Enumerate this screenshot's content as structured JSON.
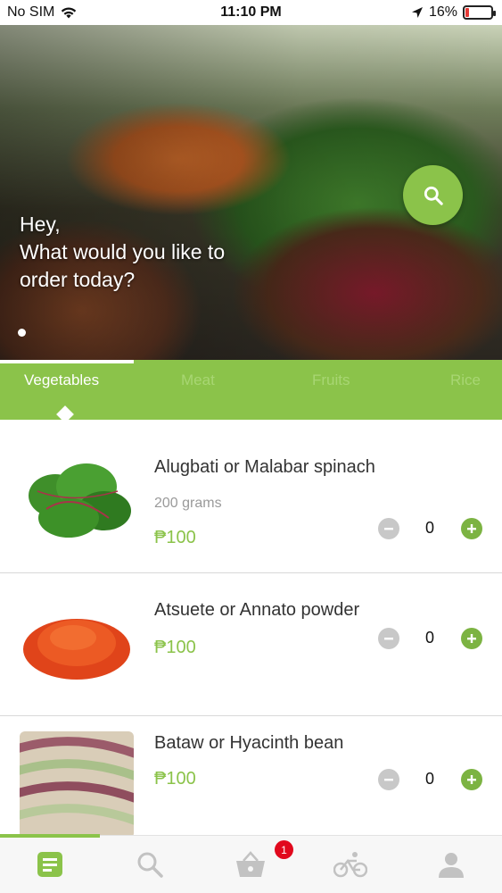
{
  "status_bar": {
    "carrier": "No SIM",
    "time": "11:10 PM",
    "battery": "16%",
    "battery_level": 0.16
  },
  "hero": {
    "greeting_line1": "Hey,",
    "greeting_line2": "What would you like to",
    "greeting_line3": "order today?"
  },
  "tabs": [
    {
      "label": "Vegetables",
      "active": true
    },
    {
      "label": "Meat",
      "active": false
    },
    {
      "label": "Fruits",
      "active": false
    },
    {
      "label": "Rice",
      "active": false
    }
  ],
  "products": [
    {
      "name": "Alugbati or Malabar spinach",
      "weight": "200 grams",
      "price": "₱100",
      "quantity": "0"
    },
    {
      "name": "Atsuete or Annato powder",
      "weight": "",
      "price": "₱100",
      "quantity": "0"
    },
    {
      "name": "Bataw or Hyacinth bean",
      "weight": "",
      "price": "₱100",
      "quantity": "0"
    }
  ],
  "bottom_nav": {
    "cart_badge": "1",
    "items": [
      "menu-icon",
      "search-icon",
      "basket-icon",
      "bicycle-icon",
      "profile-icon"
    ]
  },
  "colors": {
    "accent": "#8bc34a",
    "badge": "#e1091d"
  }
}
